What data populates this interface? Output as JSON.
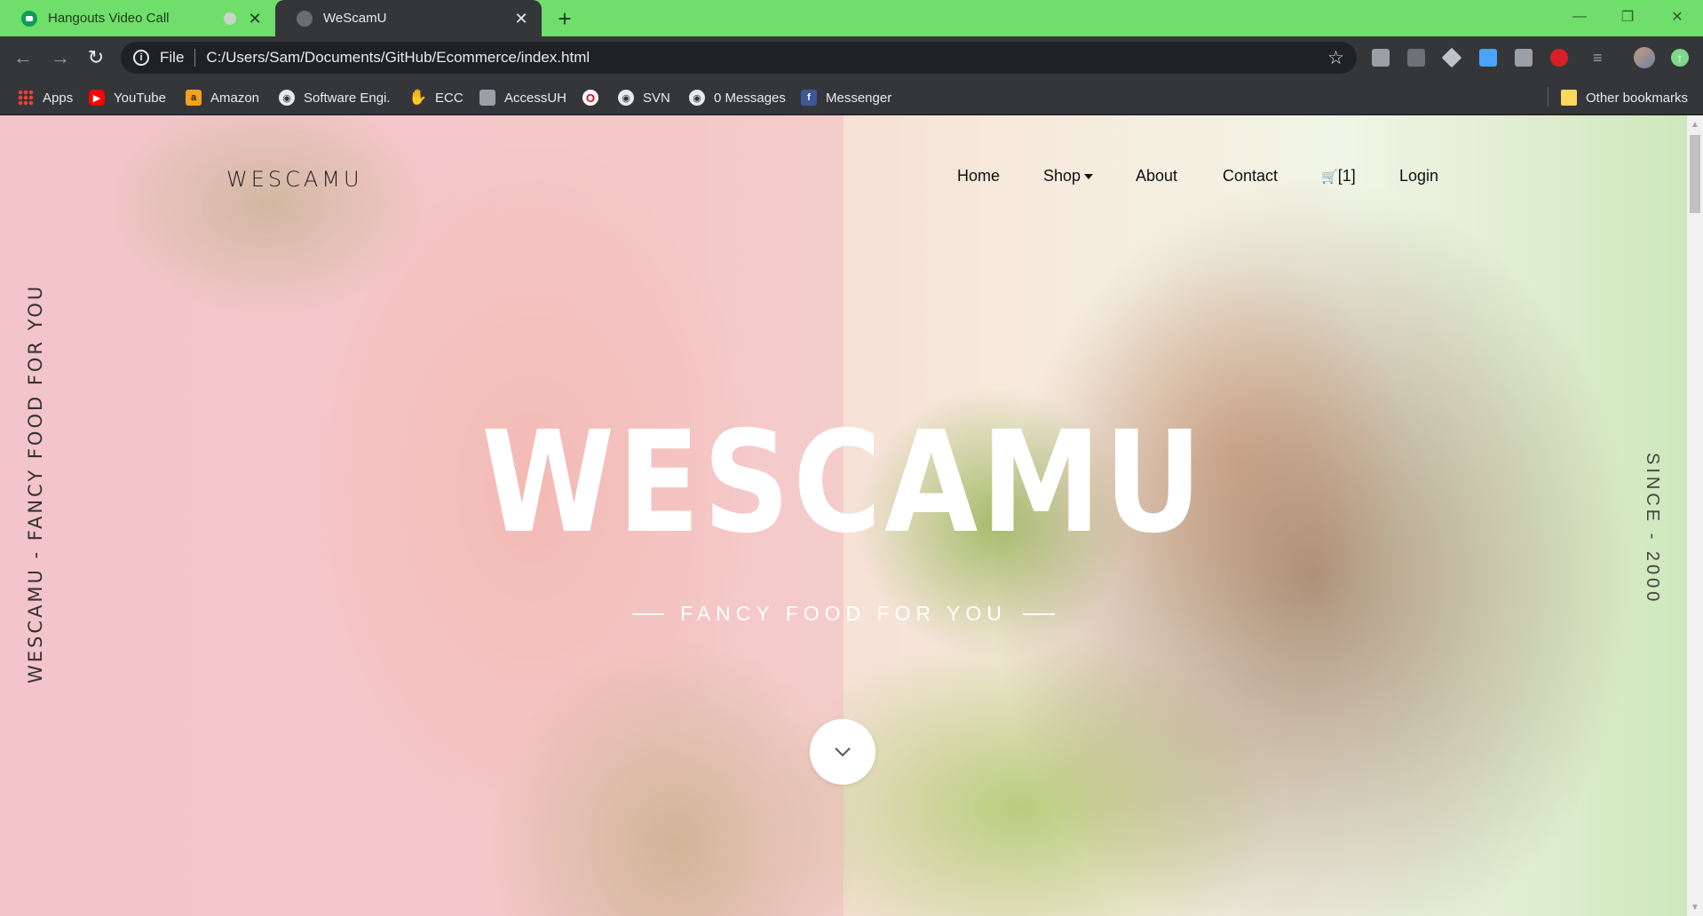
{
  "browser": {
    "tabs": [
      {
        "title": "Hangouts Video Call",
        "active": false
      },
      {
        "title": "WeScamU",
        "active": true
      }
    ],
    "new_tab": "+",
    "window_controls": {
      "minimize": "—",
      "restore": "❐",
      "close": "✕"
    },
    "address": {
      "scheme": "File",
      "url": "C:/Users/Sam/Documents/GitHub/Ecommerce/index.html"
    },
    "bookmarks": [
      {
        "label": "Apps",
        "icon": "apps-grid-icon"
      },
      {
        "label": "YouTube",
        "icon": "youtube-icon"
      },
      {
        "label": "Amazon",
        "icon": "amazon-icon"
      },
      {
        "label": "Software Engi.",
        "icon": "globe-icon"
      },
      {
        "label": "ECC",
        "icon": "ecc-icon"
      },
      {
        "label": "AccessUH",
        "icon": "accessuh-icon"
      },
      {
        "label": "",
        "icon": "opera-icon"
      },
      {
        "label": "SVN",
        "icon": "globe-icon"
      },
      {
        "label": "0 Messages",
        "icon": "globe-icon"
      },
      {
        "label": "Messenger",
        "icon": "facebook-icon"
      }
    ],
    "other_bookmarks": "Other bookmarks",
    "colors": {
      "tab_strip": "#6fde6b",
      "toolbar": "#35363a"
    }
  },
  "site": {
    "brand": "WESCAMU",
    "nav": {
      "home": "Home",
      "shop": "Shop",
      "about": "About",
      "contact": "Contact",
      "cart_icon": "🛒",
      "cart_count": "[1]",
      "login": "Login"
    },
    "side_left": "WESCAMU - FANCY FOOD FOR YOU",
    "side_right": "SINCE - 2000",
    "hero": {
      "title": "WESCAMU",
      "subtitle": "FANCY FOOD FOR YOU"
    }
  }
}
